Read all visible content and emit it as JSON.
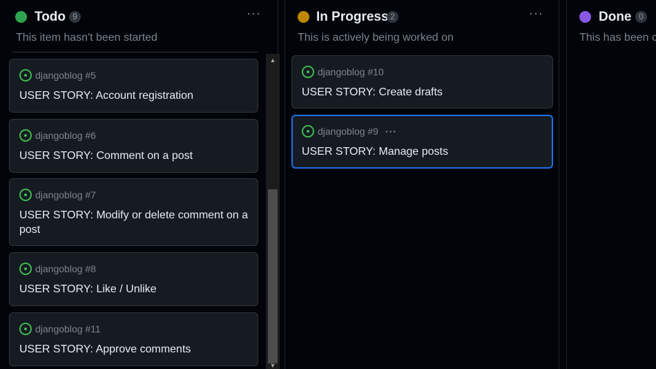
{
  "columns": [
    {
      "title": "Todo",
      "count": "9",
      "description": "This item hasn't been started",
      "status_color": "#2da44e",
      "menu_glyph": "···",
      "cards": [
        {
          "repo": "djangoblog #5",
          "title": "USER STORY: Account registration"
        },
        {
          "repo": "djangoblog #6",
          "title": "USER STORY: Comment on a post"
        },
        {
          "repo": "djangoblog #7",
          "title": "USER STORY: Modify or delete comment on a post"
        },
        {
          "repo": "djangoblog #8",
          "title": "USER STORY: Like / Unlike"
        },
        {
          "repo": "djangoblog #11",
          "title": "USER STORY: Approve comments"
        }
      ]
    },
    {
      "title": "In Progress",
      "count": "2",
      "description": "This is actively being worked on",
      "status_color": "#bf8700",
      "menu_glyph": "···",
      "cards": [
        {
          "repo": "djangoblog #10",
          "title": "USER STORY: Create drafts"
        },
        {
          "repo": "djangoblog #9",
          "title": "USER STORY: Manage posts",
          "dots": "···"
        }
      ]
    },
    {
      "title": "Done",
      "count": "0",
      "description": "This has been co",
      "status_color": "#8957e5"
    }
  ],
  "icons": {
    "issue": "issue-opened-icon",
    "scroll_up": "▲",
    "scroll_down": "▼"
  }
}
